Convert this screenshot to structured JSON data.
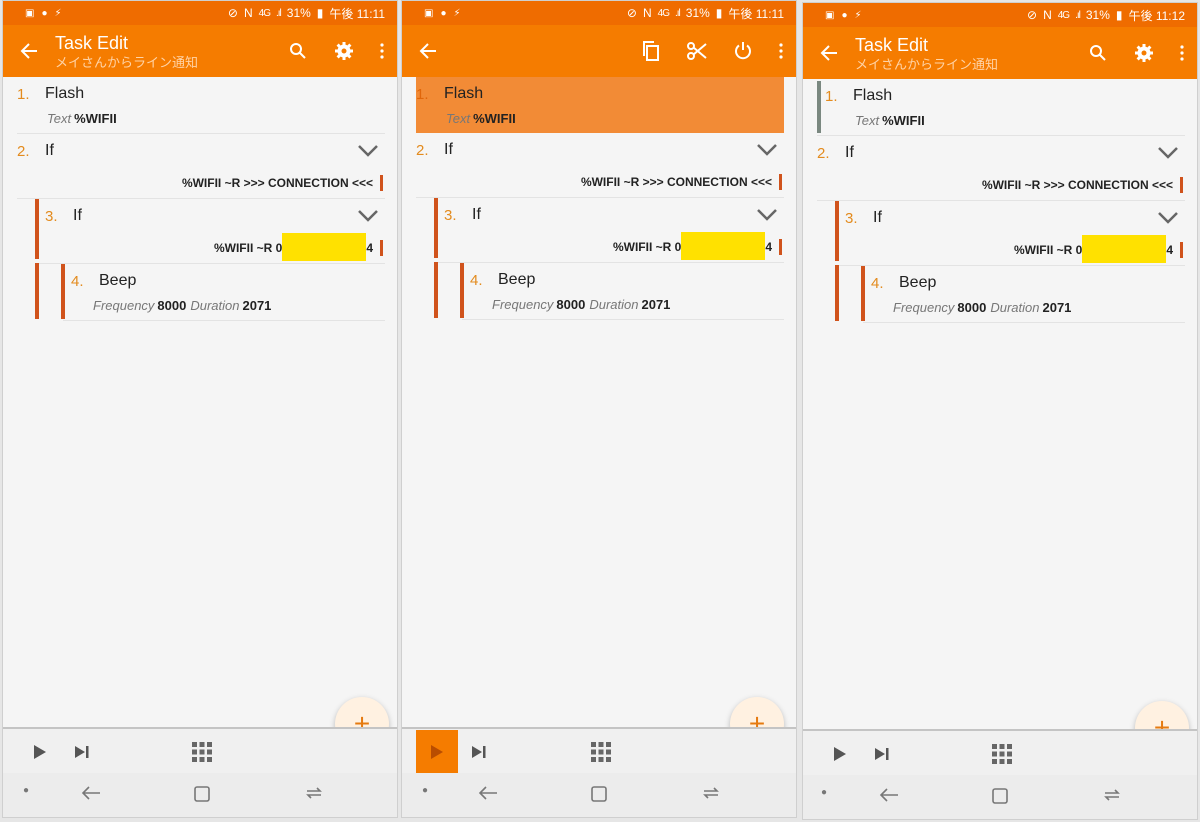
{
  "colors": {
    "accent": "#f57c00",
    "statusbar": "#ef6c00",
    "number": "#e38b1e",
    "indent_bar": "#d0531c",
    "redaction": "#ffe100"
  },
  "screens": [
    {
      "status": {
        "battery": "31%",
        "network": "4G",
        "time": "午後 11:11"
      },
      "appbar": {
        "title": "Task Edit",
        "subtitle": "メイさんからライン通知"
      },
      "actions": [
        {
          "icon": "search-icon"
        },
        {
          "icon": "gear-icon"
        },
        {
          "icon": "more-vert-icon"
        }
      ],
      "actions_list": [
        {
          "num": "1.",
          "name": "Flash",
          "param_label": "Text",
          "param_value": "%WIFII"
        },
        {
          "num": "2.",
          "name": "If",
          "condition": "%WIFII ~R >>> CONNECTION <<<"
        },
        {
          "num": "3.",
          "name": "If",
          "condition": "%WIFII ~R 0",
          "condition_end": "4"
        },
        {
          "num": "4.",
          "name": "Beep",
          "freq_label": "Frequency",
          "freq_value": "8000",
          "dur_label": "Duration",
          "dur_value": "2071"
        }
      ],
      "fab": "+"
    },
    {
      "status": {
        "battery": "31%",
        "network": "4G",
        "time": "午後 11:11"
      },
      "actions": [
        {
          "icon": "copy-icon"
        },
        {
          "icon": "scissors-icon"
        },
        {
          "icon": "power-icon"
        },
        {
          "icon": "more-vert-icon"
        }
      ],
      "actions_list": [
        {
          "num": "1.",
          "name": "Flash",
          "param_label": "Text",
          "param_value": "%WIFII",
          "selected": true
        },
        {
          "num": "2.",
          "name": "If",
          "condition": "%WIFII ~R >>> CONNECTION <<<"
        },
        {
          "num": "3.",
          "name": "If",
          "condition": "%WIFII ~R 0",
          "condition_end": "4"
        },
        {
          "num": "4.",
          "name": "Beep",
          "freq_label": "Frequency",
          "freq_value": "8000",
          "dur_label": "Duration",
          "dur_value": "2071"
        }
      ],
      "fab": "+"
    },
    {
      "status": {
        "battery": "31%",
        "network": "4G",
        "time": "午後 11:12"
      },
      "appbar": {
        "title": "Task Edit",
        "subtitle": "メイさんからライン通知"
      },
      "actions": [
        {
          "icon": "search-icon"
        },
        {
          "icon": "gear-icon"
        },
        {
          "icon": "more-vert-icon"
        }
      ],
      "actions_list": [
        {
          "num": "1.",
          "name": "Flash",
          "param_label": "Text",
          "param_value": "%WIFII"
        },
        {
          "num": "2.",
          "name": "If",
          "condition": "%WIFII ~R >>> CONNECTION <<<"
        },
        {
          "num": "3.",
          "name": "If",
          "condition": "%WIFII ~R 0",
          "condition_end": "4"
        },
        {
          "num": "4.",
          "name": "Beep",
          "freq_label": "Frequency",
          "freq_value": "8000",
          "dur_label": "Duration",
          "dur_value": "2071"
        }
      ],
      "fab": "+"
    }
  ]
}
